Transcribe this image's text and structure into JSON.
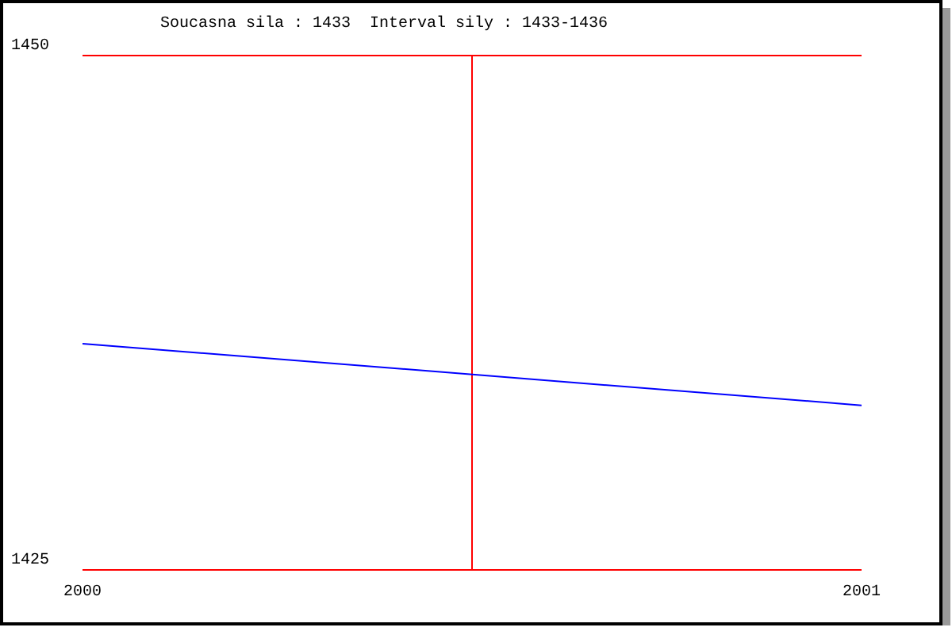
{
  "chart": {
    "chart_data": {
      "type": "line",
      "title": "Soucasna sila : 1433  Interval sily : 1433-1436",
      "x": [
        2000,
        2001
      ],
      "series": [
        {
          "color": "#0000ff",
          "values": [
            1436,
            1433
          ]
        }
      ],
      "xlim": [
        2000,
        2001
      ],
      "ylim": [
        1425,
        1450
      ],
      "xticks": [
        2000,
        2001
      ],
      "yticks": [
        1425,
        1450
      ],
      "ref_lines": [
        {
          "axis": "x",
          "value": 2000.5,
          "color": "#ff0000"
        }
      ]
    }
  }
}
